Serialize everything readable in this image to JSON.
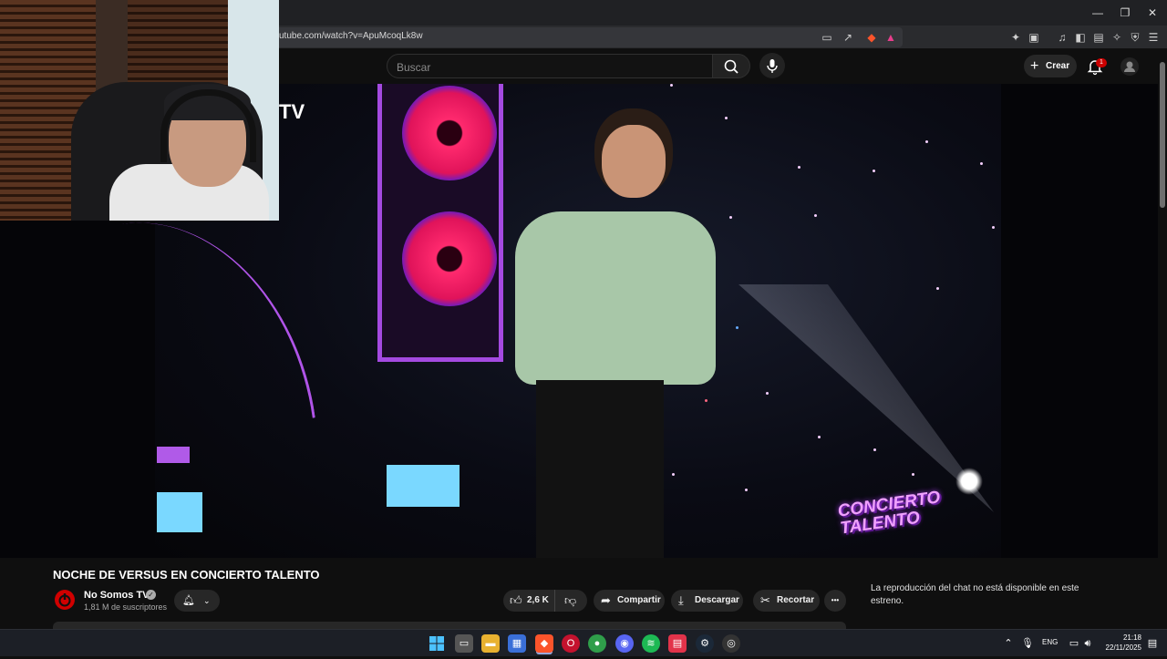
{
  "browser": {
    "url": "utube.com/watch?v=ApuMcoqLk8w",
    "window_controls": {
      "minimize": "—",
      "maximize": "❐",
      "close": "✕"
    }
  },
  "header": {
    "search_placeholder": "Buscar",
    "create_label": "Crear",
    "notification_count": "1"
  },
  "video": {
    "overlay_partial_text": "TV",
    "logo_line1": "CONCIERTO",
    "logo_line2": "TALENTO",
    "title": "NOCHE DE VERSUS EN CONCIERTO TALENTO"
  },
  "channel": {
    "name": "No Somos TV",
    "subscribers": "1,81 M de suscriptores"
  },
  "actions": {
    "likes": "2,6 K",
    "share": "Compartir",
    "download": "Descargar",
    "clip": "Recortar",
    "more": "•••"
  },
  "chat": {
    "notice": "La reproducción del chat no está disponible en este estreno."
  },
  "taskbar": {
    "lang": "ENG",
    "time": "21:18",
    "date": "22/11/2025"
  },
  "colors": {
    "accent_red": "#cc0000",
    "neon_purple": "#a44ae0",
    "speaker_pink": "#ff2a6e"
  }
}
